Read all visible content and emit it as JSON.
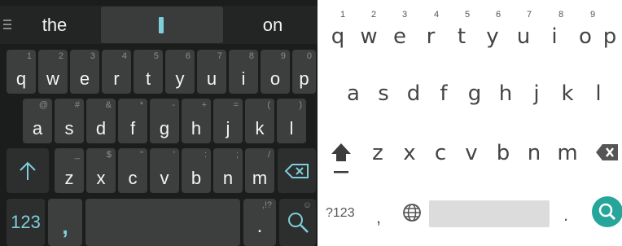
{
  "dark_keyboard": {
    "suggestions": {
      "left": "the",
      "right": "on"
    },
    "row1": [
      {
        "key": "q",
        "hint": "1"
      },
      {
        "key": "w",
        "hint": "2"
      },
      {
        "key": "e",
        "hint": "3"
      },
      {
        "key": "r",
        "hint": "4"
      },
      {
        "key": "t",
        "hint": "5"
      },
      {
        "key": "y",
        "hint": "6"
      },
      {
        "key": "u",
        "hint": "7"
      },
      {
        "key": "i",
        "hint": "8"
      },
      {
        "key": "o",
        "hint": "9"
      },
      {
        "key": "p",
        "hint": "0"
      }
    ],
    "row2": [
      {
        "key": "a",
        "hint": "@"
      },
      {
        "key": "s",
        "hint": "#"
      },
      {
        "key": "d",
        "hint": "&"
      },
      {
        "key": "f",
        "hint": "*"
      },
      {
        "key": "g",
        "hint": "-"
      },
      {
        "key": "h",
        "hint": "+"
      },
      {
        "key": "j",
        "hint": "="
      },
      {
        "key": "k",
        "hint": "("
      },
      {
        "key": "l",
        "hint": ")"
      }
    ],
    "row3": [
      {
        "key": "z",
        "hint": "_"
      },
      {
        "key": "x",
        "hint": "$"
      },
      {
        "key": "c",
        "hint": "\""
      },
      {
        "key": "v",
        "hint": "'"
      },
      {
        "key": "b",
        "hint": ":"
      },
      {
        "key": "n",
        "hint": ";"
      },
      {
        "key": "m",
        "hint": "/"
      }
    ],
    "row4": {
      "symbols": "123",
      "comma": ",",
      "period": ".",
      "period_hint": ",!?",
      "search_hint": "☺"
    },
    "icons": {
      "shift": "arrow-up-icon",
      "backspace": "backspace-icon",
      "search": "search-icon",
      "menu": "menu-icon"
    },
    "accent_color": "#7fcfdb"
  },
  "light_keyboard": {
    "row1": [
      "q",
      "w",
      "e",
      "r",
      "t",
      "y",
      "u",
      "i",
      "o",
      "p"
    ],
    "row1_numbers": [
      "1",
      "2",
      "3",
      "4",
      "5",
      "6",
      "7",
      "8",
      "9"
    ],
    "row2": [
      "a",
      "s",
      "d",
      "f",
      "g",
      "h",
      "j",
      "k",
      "l"
    ],
    "row3": [
      "z",
      "x",
      "c",
      "v",
      "b",
      "n",
      "m"
    ],
    "row4": {
      "symbols": "?123",
      "comma": ",",
      "period": "."
    },
    "icons": {
      "shift": "shift-icon",
      "backspace": "backspace-icon",
      "globe": "globe-icon",
      "search": "search-icon"
    },
    "accent_color": "#26a69a"
  }
}
